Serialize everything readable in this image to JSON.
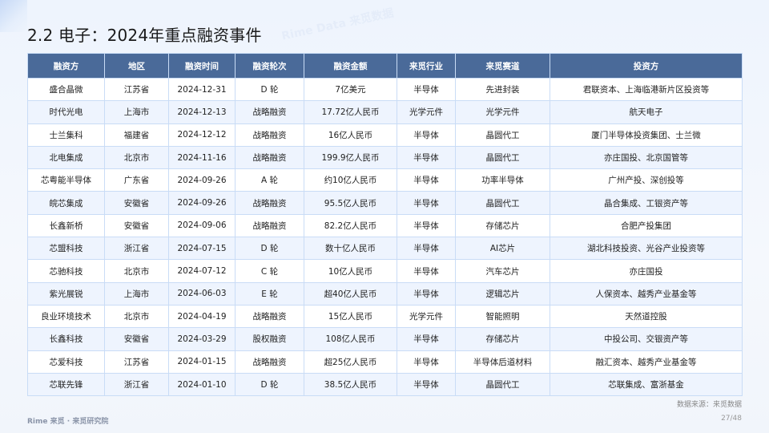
{
  "title": "2.2 电子：2024年重点融资事件",
  "table": {
    "headers": [
      "融资方",
      "地区",
      "融资时间",
      "融资轮次",
      "融资金额",
      "来觅行业",
      "来觅赛道",
      "投资方"
    ],
    "rows": [
      [
        "盛合晶微",
        "江苏省",
        "2024-12-31",
        "D 轮",
        "7亿美元",
        "半导体",
        "先进封装",
        "君联资本、上海临港新片区投资等"
      ],
      [
        "时代光电",
        "上海市",
        "2024-12-13",
        "战略融资",
        "17.72亿人民币",
        "光学元件",
        "光学元件",
        "航天电子"
      ],
      [
        "士兰集科",
        "福建省",
        "2024-12-12",
        "战略融资",
        "16亿人民币",
        "半导体",
        "晶圆代工",
        "厦门半导体投资集团、士兰微"
      ],
      [
        "北电集成",
        "北京市",
        "2024-11-16",
        "战略融资",
        "199.9亿人民币",
        "半导体",
        "晶圆代工",
        "亦庄国投、北京国管等"
      ],
      [
        "芯粤能半导体",
        "广东省",
        "2024-09-26",
        "A 轮",
        "约10亿人民币",
        "半导体",
        "功率半导体",
        "广州产投、深创投等"
      ],
      [
        "皖芯集成",
        "安徽省",
        "2024-09-26",
        "战略融资",
        "95.5亿人民币",
        "半导体",
        "晶圆代工",
        "晶合集成、工银资产等"
      ],
      [
        "长鑫新桥",
        "安徽省",
        "2024-09-06",
        "战略融资",
        "82.2亿人民币",
        "半导体",
        "存储芯片",
        "合肥产投集团"
      ],
      [
        "芯盟科技",
        "浙江省",
        "2024-07-15",
        "D 轮",
        "数十亿人民币",
        "半导体",
        "AI芯片",
        "湖北科技投资、光谷产业投资等"
      ],
      [
        "芯驰科技",
        "北京市",
        "2024-07-12",
        "C 轮",
        "10亿人民币",
        "半导体",
        "汽车芯片",
        "亦庄国投"
      ],
      [
        "紫光展锐",
        "上海市",
        "2024-06-03",
        "E 轮",
        "超40亿人民币",
        "半导体",
        "逻辑芯片",
        "人保资本、越秀产业基金等"
      ],
      [
        "良业环境技术",
        "北京市",
        "2024-04-19",
        "战略融资",
        "15亿人民币",
        "光学元件",
        "智能照明",
        "天然道控股"
      ],
      [
        "长鑫科技",
        "安徽省",
        "2024-03-29",
        "股权融资",
        "108亿人民币",
        "半导体",
        "存储芯片",
        "中投公司、交银资产等"
      ],
      [
        "芯爱科技",
        "江苏省",
        "2024-01-15",
        "战略融资",
        "超25亿人民币",
        "半导体",
        "半导体后道材料",
        "融汇资本、越秀产业基金等"
      ],
      [
        "芯联先锋",
        "浙江省",
        "2024-01-10",
        "D 轮",
        "38.5亿人民币",
        "半导体",
        "晶圆代工",
        "芯联集成、富浙基金"
      ]
    ]
  },
  "source": "数据来源：来觅数据",
  "page": "27/48",
  "footer": "Rime 来觅 · 来觅研究院",
  "watermark": "Rime Data 来觅数据",
  "colors": {
    "header_bg": "#4a6a99",
    "row_alt": "#eef4fe",
    "border": "#c9dcf6"
  }
}
